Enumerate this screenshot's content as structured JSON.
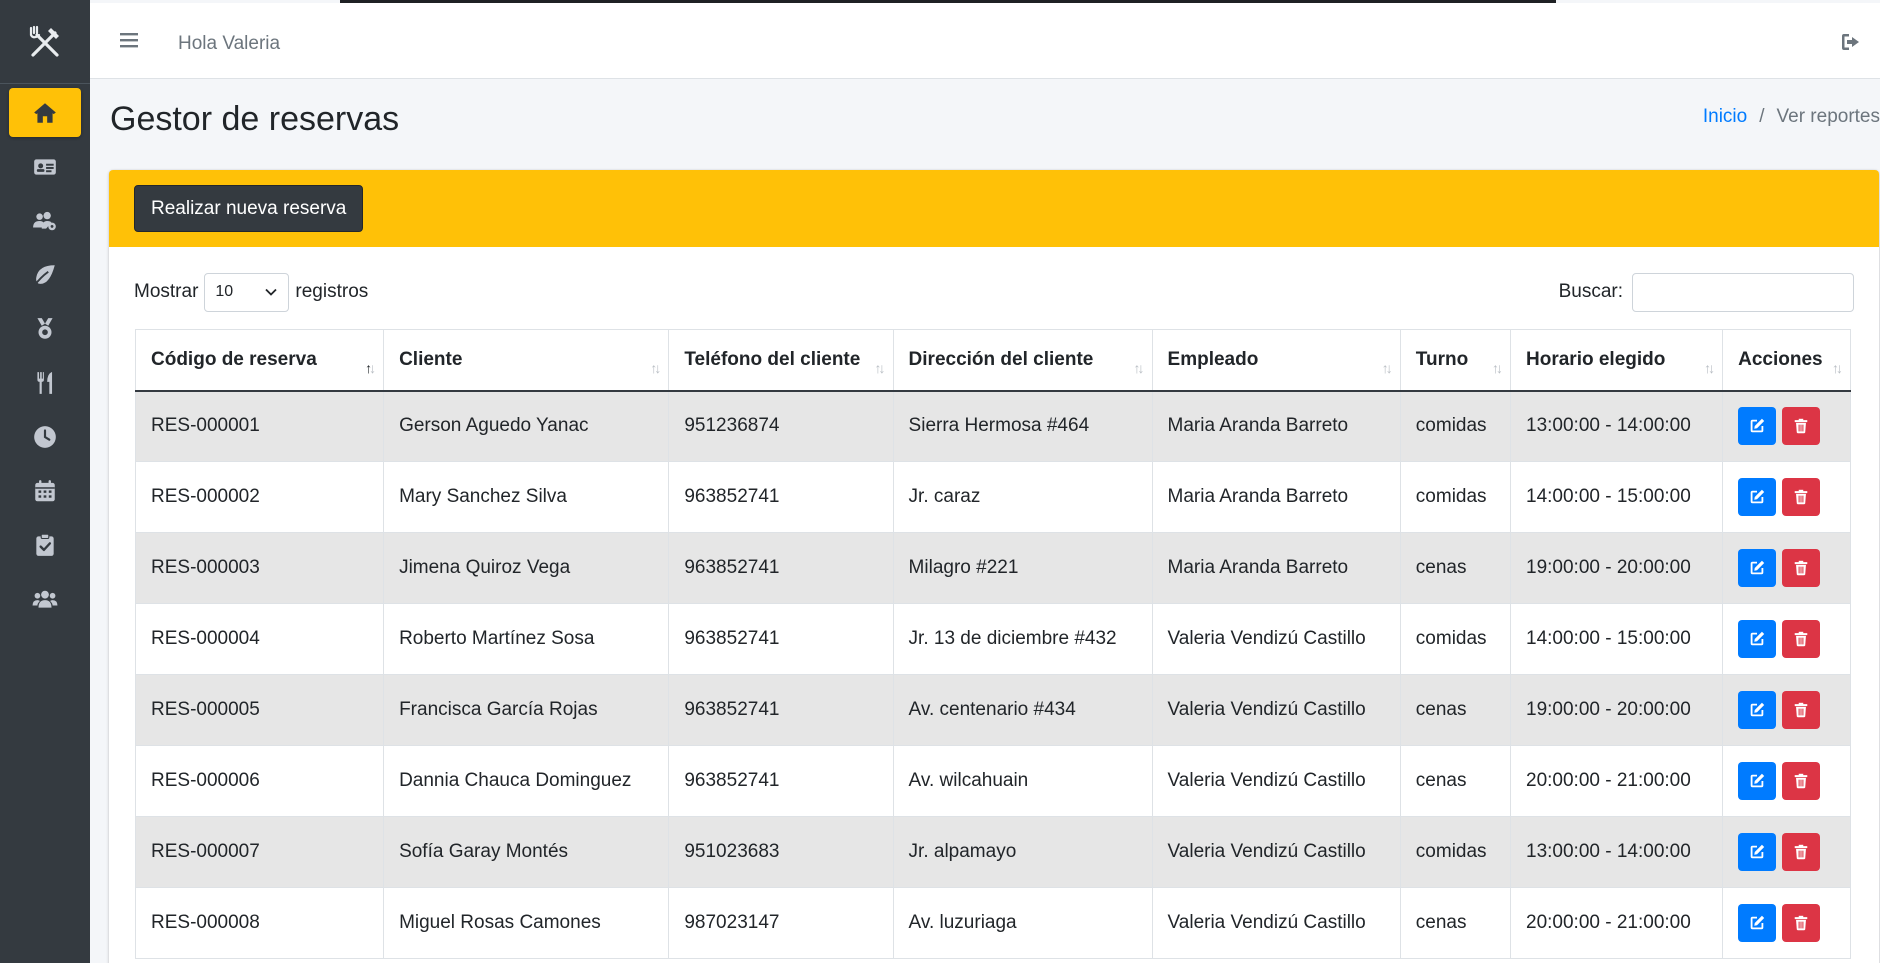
{
  "navbar": {
    "greeting": "Hola Valeria"
  },
  "sidebar": {
    "logo_icon": "utensils-cross-icon",
    "items": [
      {
        "icon": "home-icon",
        "active": true
      },
      {
        "icon": "id-card-icon",
        "active": false
      },
      {
        "icon": "users-cog-icon",
        "active": false
      },
      {
        "icon": "leaf-icon",
        "active": false
      },
      {
        "icon": "medal-icon",
        "active": false
      },
      {
        "icon": "utensils-icon",
        "active": false
      },
      {
        "icon": "clock-icon",
        "active": false
      },
      {
        "icon": "calendar-icon",
        "active": false
      },
      {
        "icon": "clipboard-check-icon",
        "active": false
      },
      {
        "icon": "users-icon",
        "active": false
      }
    ]
  },
  "header": {
    "title": "Gestor de reservas",
    "breadcrumb": {
      "home": "Inicio",
      "sep": "/",
      "current": "Ver reportes"
    }
  },
  "card": {
    "new_button": "Realizar nueva reserva"
  },
  "datatable": {
    "length_prefix": "Mostrar",
    "length_value": "10",
    "length_suffix": "registros",
    "search_label": "Buscar:",
    "search_value": "",
    "columns": [
      "Código de reserva",
      "Cliente",
      "Teléfono del cliente",
      "Dirección del cliente",
      "Empleado",
      "Turno",
      "Horario elegido",
      "Acciones"
    ],
    "rows": [
      [
        "RES-000001",
        "Gerson Aguedo Yanac",
        "951236874",
        "Sierra Hermosa #464",
        "Maria Aranda Barreto",
        "comidas",
        "13:00:00 - 14:00:00"
      ],
      [
        "RES-000002",
        "Mary Sanchez Silva",
        "963852741",
        "Jr. caraz",
        "Maria Aranda Barreto",
        "comidas",
        "14:00:00 - 15:00:00"
      ],
      [
        "RES-000003",
        "Jimena Quiroz Vega",
        "963852741",
        "Milagro #221",
        "Maria Aranda Barreto",
        "cenas",
        "19:00:00 - 20:00:00"
      ],
      [
        "RES-000004",
        "Roberto Martínez Sosa",
        "963852741",
        "Jr. 13 de diciembre #432",
        "Valeria Vendizú Castillo",
        "comidas",
        "14:00:00 - 15:00:00"
      ],
      [
        "RES-000005",
        "Francisca García Rojas",
        "963852741",
        "Av. centenario #434",
        "Valeria Vendizú Castillo",
        "cenas",
        "19:00:00 - 20:00:00"
      ],
      [
        "RES-000006",
        "Dannia Chauca Dominguez",
        "963852741",
        "Av. wilcahuain",
        "Valeria Vendizú Castillo",
        "cenas",
        "20:00:00 - 21:00:00"
      ],
      [
        "RES-000007",
        "Sofía Garay Montés",
        "951023683",
        "Jr. alpamayo",
        "Valeria Vendizú Castillo",
        "comidas",
        "13:00:00 - 14:00:00"
      ],
      [
        "RES-000008",
        "Miguel Rosas Camones",
        "987023147",
        "Av. luzuriaga",
        "Valeria Vendizú Castillo",
        "cenas",
        "20:00:00 - 21:00:00"
      ]
    ]
  },
  "colors": {
    "accent": "#ffc107",
    "sidebar": "#343a40",
    "edit": "#007bff",
    "delete": "#dc3545"
  }
}
